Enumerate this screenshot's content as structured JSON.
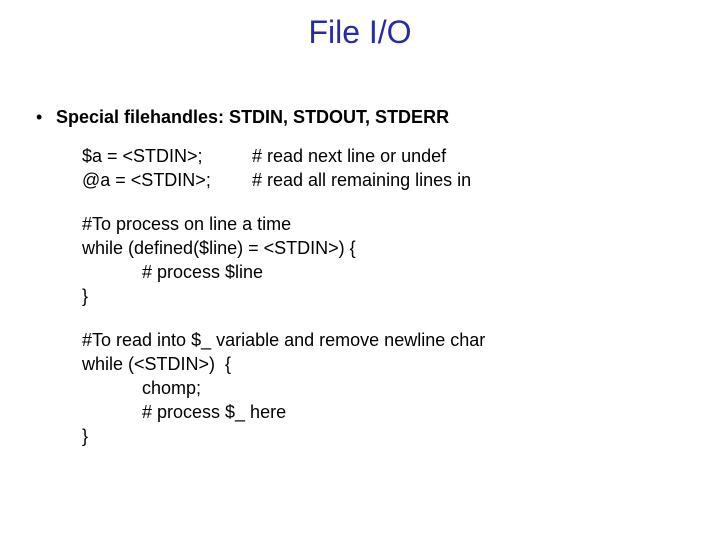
{
  "title": "File I/O",
  "bullet1": "Special filehandles: STDIN, STDOUT, STDERR",
  "example1": {
    "row1_left": "$a = <STDIN>;",
    "row1_right": "# read next line or undef",
    "row2_left": "@a = <STDIN>;",
    "row2_right": "# read all remaining lines in"
  },
  "example2": {
    "line1": "#To process on line a time",
    "line2": "while (defined($line) = <STDIN>) {",
    "line3": "# process $line",
    "line4": "}"
  },
  "example3": {
    "line1": "#To read into $_ variable and remove newline char",
    "line2": "while (<STDIN>)  {",
    "line3": "chomp;",
    "line4": "# process $_ here",
    "line5": "}"
  }
}
